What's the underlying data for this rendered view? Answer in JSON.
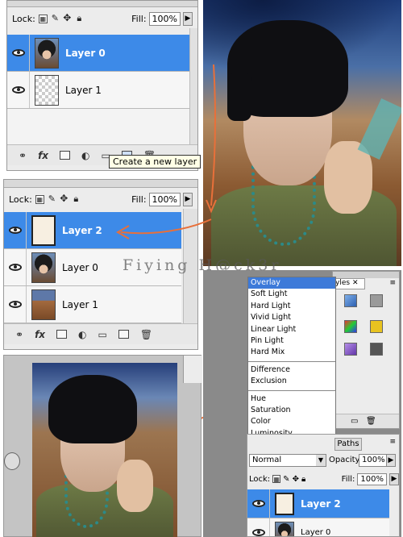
{
  "panel_top": {
    "lock_label": "Lock:",
    "fill_label": "Fill:",
    "fill_value": "100%",
    "layers": [
      {
        "name": "Layer 0",
        "selected": true,
        "thumb": "portrait"
      },
      {
        "name": "Layer 1",
        "selected": false,
        "thumb": "transparent"
      }
    ],
    "tooltip": "Create a new layer"
  },
  "panel_mid": {
    "lock_label": "Lock:",
    "fill_label": "Fill:",
    "fill_value": "100%",
    "layers": [
      {
        "name": "Layer 2",
        "selected": true,
        "thumb": "cream"
      },
      {
        "name": "Layer 0",
        "selected": false,
        "thumb": "portrait"
      },
      {
        "name": "Layer 1",
        "selected": false,
        "thumb": "desert"
      }
    ]
  },
  "blend_menu": {
    "groups": [
      [
        "Overlay",
        "Soft Light",
        "Hard Light",
        "Vivid Light",
        "Linear Light",
        "Pin Light",
        "Hard Mix"
      ],
      [
        "Difference",
        "Exclusion"
      ],
      [
        "Hue",
        "Saturation",
        "Color",
        "Luminosity"
      ]
    ],
    "highlighted": "Overlay"
  },
  "styles_tab": "yles",
  "paths_tab": "Paths",
  "panel_bottom": {
    "mode_value": "Normal",
    "opacity_label": "Opacity:",
    "opacity_value": "100%",
    "lock_label": "Lock:",
    "fill_label": "Fill:",
    "fill_value": "100%",
    "layers": [
      {
        "name": "Layer 2",
        "selected": true,
        "thumb": "cream"
      },
      {
        "name": "Layer 0",
        "selected": false,
        "thumb": "portrait"
      }
    ]
  },
  "watermark": "Fiying H@ck3r",
  "colors": {
    "selection": "#3d8ae8",
    "arrow": "#e8703a",
    "panel": "#ececec"
  }
}
